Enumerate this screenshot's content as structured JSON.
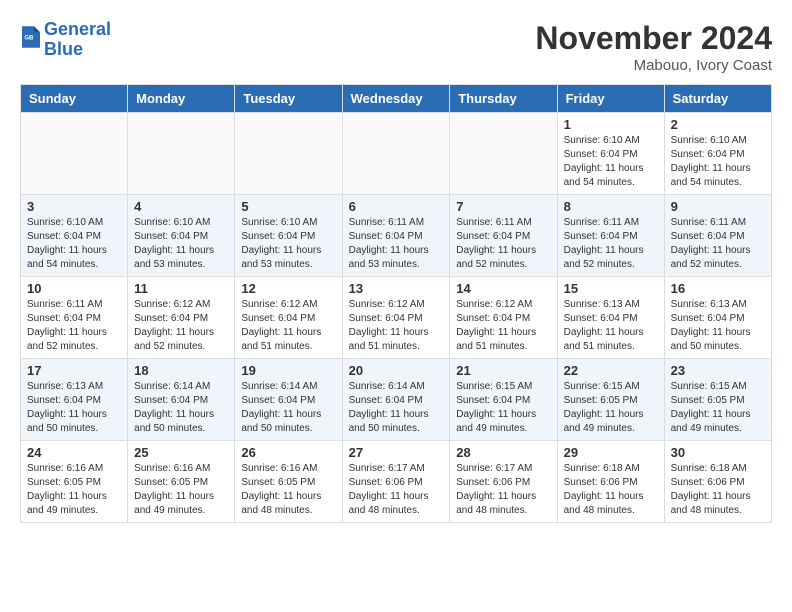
{
  "header": {
    "logo_line1": "General",
    "logo_line2": "Blue",
    "month": "November 2024",
    "location": "Mabouo, Ivory Coast"
  },
  "days_of_week": [
    "Sunday",
    "Monday",
    "Tuesday",
    "Wednesday",
    "Thursday",
    "Friday",
    "Saturday"
  ],
  "weeks": [
    [
      {
        "day": "",
        "info": ""
      },
      {
        "day": "",
        "info": ""
      },
      {
        "day": "",
        "info": ""
      },
      {
        "day": "",
        "info": ""
      },
      {
        "day": "",
        "info": ""
      },
      {
        "day": "1",
        "info": "Sunrise: 6:10 AM\nSunset: 6:04 PM\nDaylight: 11 hours and 54 minutes."
      },
      {
        "day": "2",
        "info": "Sunrise: 6:10 AM\nSunset: 6:04 PM\nDaylight: 11 hours and 54 minutes."
      }
    ],
    [
      {
        "day": "3",
        "info": "Sunrise: 6:10 AM\nSunset: 6:04 PM\nDaylight: 11 hours and 54 minutes."
      },
      {
        "day": "4",
        "info": "Sunrise: 6:10 AM\nSunset: 6:04 PM\nDaylight: 11 hours and 53 minutes."
      },
      {
        "day": "5",
        "info": "Sunrise: 6:10 AM\nSunset: 6:04 PM\nDaylight: 11 hours and 53 minutes."
      },
      {
        "day": "6",
        "info": "Sunrise: 6:11 AM\nSunset: 6:04 PM\nDaylight: 11 hours and 53 minutes."
      },
      {
        "day": "7",
        "info": "Sunrise: 6:11 AM\nSunset: 6:04 PM\nDaylight: 11 hours and 52 minutes."
      },
      {
        "day": "8",
        "info": "Sunrise: 6:11 AM\nSunset: 6:04 PM\nDaylight: 11 hours and 52 minutes."
      },
      {
        "day": "9",
        "info": "Sunrise: 6:11 AM\nSunset: 6:04 PM\nDaylight: 11 hours and 52 minutes."
      }
    ],
    [
      {
        "day": "10",
        "info": "Sunrise: 6:11 AM\nSunset: 6:04 PM\nDaylight: 11 hours and 52 minutes."
      },
      {
        "day": "11",
        "info": "Sunrise: 6:12 AM\nSunset: 6:04 PM\nDaylight: 11 hours and 52 minutes."
      },
      {
        "day": "12",
        "info": "Sunrise: 6:12 AM\nSunset: 6:04 PM\nDaylight: 11 hours and 51 minutes."
      },
      {
        "day": "13",
        "info": "Sunrise: 6:12 AM\nSunset: 6:04 PM\nDaylight: 11 hours and 51 minutes."
      },
      {
        "day": "14",
        "info": "Sunrise: 6:12 AM\nSunset: 6:04 PM\nDaylight: 11 hours and 51 minutes."
      },
      {
        "day": "15",
        "info": "Sunrise: 6:13 AM\nSunset: 6:04 PM\nDaylight: 11 hours and 51 minutes."
      },
      {
        "day": "16",
        "info": "Sunrise: 6:13 AM\nSunset: 6:04 PM\nDaylight: 11 hours and 50 minutes."
      }
    ],
    [
      {
        "day": "17",
        "info": "Sunrise: 6:13 AM\nSunset: 6:04 PM\nDaylight: 11 hours and 50 minutes."
      },
      {
        "day": "18",
        "info": "Sunrise: 6:14 AM\nSunset: 6:04 PM\nDaylight: 11 hours and 50 minutes."
      },
      {
        "day": "19",
        "info": "Sunrise: 6:14 AM\nSunset: 6:04 PM\nDaylight: 11 hours and 50 minutes."
      },
      {
        "day": "20",
        "info": "Sunrise: 6:14 AM\nSunset: 6:04 PM\nDaylight: 11 hours and 50 minutes."
      },
      {
        "day": "21",
        "info": "Sunrise: 6:15 AM\nSunset: 6:04 PM\nDaylight: 11 hours and 49 minutes."
      },
      {
        "day": "22",
        "info": "Sunrise: 6:15 AM\nSunset: 6:05 PM\nDaylight: 11 hours and 49 minutes."
      },
      {
        "day": "23",
        "info": "Sunrise: 6:15 AM\nSunset: 6:05 PM\nDaylight: 11 hours and 49 minutes."
      }
    ],
    [
      {
        "day": "24",
        "info": "Sunrise: 6:16 AM\nSunset: 6:05 PM\nDaylight: 11 hours and 49 minutes."
      },
      {
        "day": "25",
        "info": "Sunrise: 6:16 AM\nSunset: 6:05 PM\nDaylight: 11 hours and 49 minutes."
      },
      {
        "day": "26",
        "info": "Sunrise: 6:16 AM\nSunset: 6:05 PM\nDaylight: 11 hours and 48 minutes."
      },
      {
        "day": "27",
        "info": "Sunrise: 6:17 AM\nSunset: 6:06 PM\nDaylight: 11 hours and 48 minutes."
      },
      {
        "day": "28",
        "info": "Sunrise: 6:17 AM\nSunset: 6:06 PM\nDaylight: 11 hours and 48 minutes."
      },
      {
        "day": "29",
        "info": "Sunrise: 6:18 AM\nSunset: 6:06 PM\nDaylight: 11 hours and 48 minutes."
      },
      {
        "day": "30",
        "info": "Sunrise: 6:18 AM\nSunset: 6:06 PM\nDaylight: 11 hours and 48 minutes."
      }
    ]
  ]
}
